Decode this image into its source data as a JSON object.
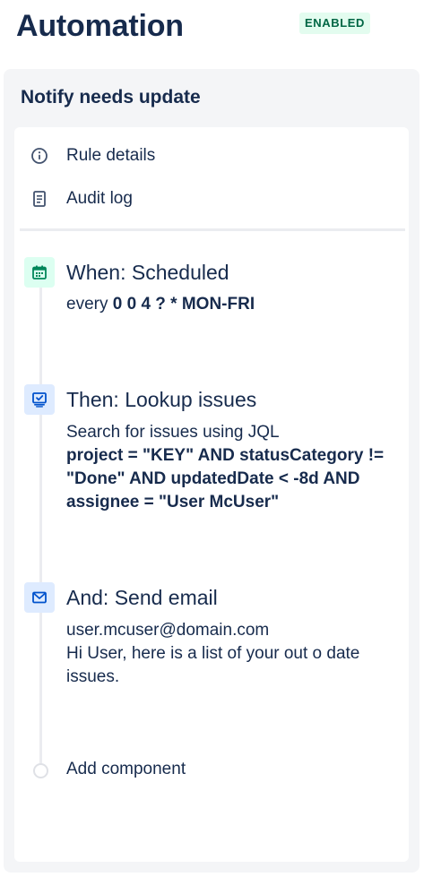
{
  "header": {
    "title": "Automation",
    "status_badge": "ENABLED"
  },
  "rule": {
    "name": "Notify needs update"
  },
  "menu": [
    {
      "label": "Rule details",
      "icon": "info-icon"
    },
    {
      "label": "Audit log",
      "icon": "document-icon"
    }
  ],
  "steps": {
    "trigger": {
      "title": "When: Scheduled",
      "prefix": "every",
      "cron": "0 0 4 ? * MON-FRI",
      "icon": "calendar-icon"
    },
    "lookup": {
      "title": "Then: Lookup issues",
      "desc": "Search for issues using JQL",
      "jql_line1": "project = \"KEY\" AND statusCategory !=",
      "jql_line2": "\"Done\" AND updatedDate < -8d AND",
      "jql_line3": "assignee = \"User McUser\"",
      "icon": "lookup-icon"
    },
    "email": {
      "title": "And: Send email",
      "to": "user.mcuser@domain.com",
      "body_line1": "Hi User, here is a list of your out o date",
      "body_line2": "issues.",
      "icon": "mail-icon"
    }
  },
  "add_component": {
    "label": "Add component"
  },
  "colors": {
    "text": "#172b4d",
    "badge_bg": "#e3fcef",
    "badge_text": "#006644",
    "trigger_icon": "#00875a",
    "action_icon": "#0052cc",
    "panel_bg": "#f4f5f7"
  }
}
